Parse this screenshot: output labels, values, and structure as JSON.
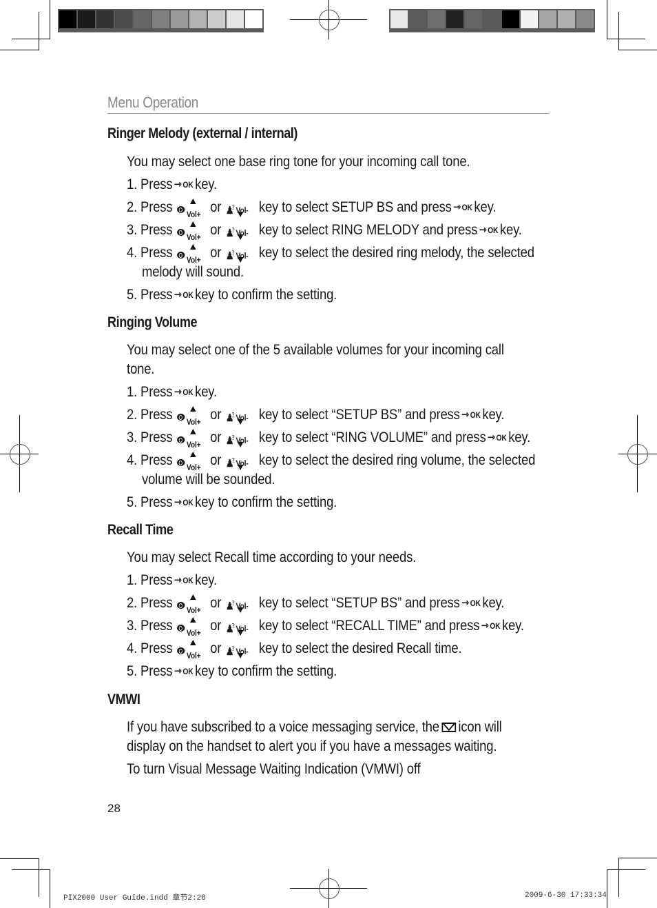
{
  "header": {
    "section_title": "Menu Operation"
  },
  "icons": {
    "ok_key": {
      "arrow": "⇾",
      "label": "OK"
    },
    "vol_up_key": {
      "label": "Vol+"
    },
    "vol_down_key": {
      "label": "Vol-",
      "man": "♟",
      "question": "?"
    }
  },
  "sections": [
    {
      "title": "Ringer Melody (external / internal)",
      "intro": "You may select one base ring tone for your incoming call tone.",
      "steps": [
        {
          "num": "1. Press",
          "after_ok": "key."
        },
        {
          "num": "2. Press",
          "or": "or",
          "mid": "key to select SETUP BS and press",
          "after_ok": "key."
        },
        {
          "num": "3. Press",
          "or": "or",
          "mid": "key to select RING MELODY and press",
          "after_ok": "key."
        },
        {
          "num": "4. Press",
          "or": "or",
          "mid": "key to select the desired ring melody, the selected",
          "cont": "melody will sound."
        },
        {
          "num": "5. Press",
          "after_ok": "key to confirm the setting."
        }
      ]
    },
    {
      "title": "Ringing Volume",
      "intro_line1": "You may select one of the 5 available volumes for your incoming call",
      "intro_line2": "tone.",
      "steps": [
        {
          "num": "1. Press",
          "after_ok": "key."
        },
        {
          "num": "2. Press",
          "or": "or",
          "mid": "key to select “SETUP BS” and press",
          "after_ok": "key."
        },
        {
          "num": "3. Press",
          "or": "or",
          "mid": "key to select “RING VOLUME” and press",
          "after_ok": "key."
        },
        {
          "num": "4. Press",
          "or": "or",
          "mid": "key to select the desired ring volume, the selected",
          "cont": "volume will be sounded."
        },
        {
          "num": "5. Press",
          "after_ok": "key to confirm the setting."
        }
      ]
    },
    {
      "title": "Recall Time",
      "intro": "You may select Recall time according to your needs.",
      "steps": [
        {
          "num": "1. Press",
          "after_ok": "key."
        },
        {
          "num": "2. Press",
          "or": "or",
          "mid": "key to select “SETUP BS” and press",
          "after_ok": "key."
        },
        {
          "num": "3. Press",
          "or": "or",
          "mid": "key to select “RECALL TIME” and press",
          "after_ok": "key."
        },
        {
          "num": "4. Press",
          "or": "or",
          "mid": "key to select the desired Recall time."
        },
        {
          "num": "5. Press",
          "after_ok": "key to confirm the setting."
        }
      ]
    },
    {
      "title": "VMWI",
      "para1_before_icon": "If you have subscribed to a voice messaging service, the",
      "para1_after_icon": "icon will",
      "para1_line2": "display on the handset to alert you if you have a messages waiting.",
      "para2": "To turn Visual Message Waiting Indication (VMWI) off"
    }
  ],
  "footer": {
    "page_number": "28",
    "slug_left": "PIX2000 User Guide.indd   章节2:28",
    "slug_right": "2009-6-30   17:33:34"
  },
  "print_marks": {
    "swatches_left": [
      "#000000",
      "#1a1a1a",
      "#333333",
      "#4d4d4d",
      "#666666",
      "#808080",
      "#999999",
      "#b3b3b3",
      "#cccccc",
      "#e6e6e6",
      "#ffffff"
    ],
    "swatches_right": [
      "#e8e8e8",
      "#5c5c5c",
      "#707070",
      "#222222",
      "#666666",
      "#5a5a5a",
      "#000000",
      "#f2f2f2",
      "#a6a6a6",
      "#b0b0b0",
      "#8a8a8a"
    ]
  }
}
